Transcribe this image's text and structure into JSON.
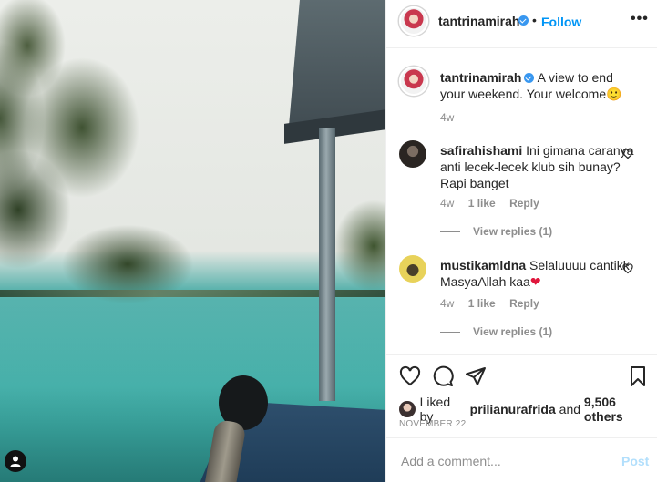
{
  "header": {
    "username": "tantrinamirah",
    "verified": true,
    "separator": "•",
    "follow_label": "Follow",
    "more_icon": "more-horizontal-icon"
  },
  "caption": {
    "username": "tantrinamirah",
    "text": "A view to end your weekend. Your welcome",
    "emoji": "🙂",
    "time": "4w"
  },
  "comments": [
    {
      "username": "safirahishami",
      "text": "Ini gimana caranya anti lecek-lecek klub sih bunay? Rapi banget",
      "emoji": "",
      "time": "4w",
      "likes": "1 like",
      "reply_label": "Reply",
      "view_replies": "View replies (1)"
    },
    {
      "username": "mustikamldna",
      "text": "Selaluuuu cantikk, MasyaAllah kaa",
      "emoji": "❤",
      "time": "4w",
      "likes": "1 like",
      "reply_label": "Reply",
      "view_replies": "View replies (1)"
    }
  ],
  "actions": {
    "icons": [
      "heart-icon",
      "comment-icon",
      "share-icon",
      "bookmark-icon"
    ]
  },
  "likes": {
    "prefix": "Liked by",
    "user": "prilianurafrida",
    "joiner": "and",
    "others": "9,506 others"
  },
  "date": "NOVEMBER 22",
  "add_comment": {
    "placeholder": "Add a comment...",
    "post_label": "Post"
  },
  "colors": {
    "accent": "#0095f6",
    "verified": "#3897f0",
    "heart_emoji": "#e0173c",
    "muted": "#8e8e8e",
    "post_disabled": "#b2dffc"
  }
}
